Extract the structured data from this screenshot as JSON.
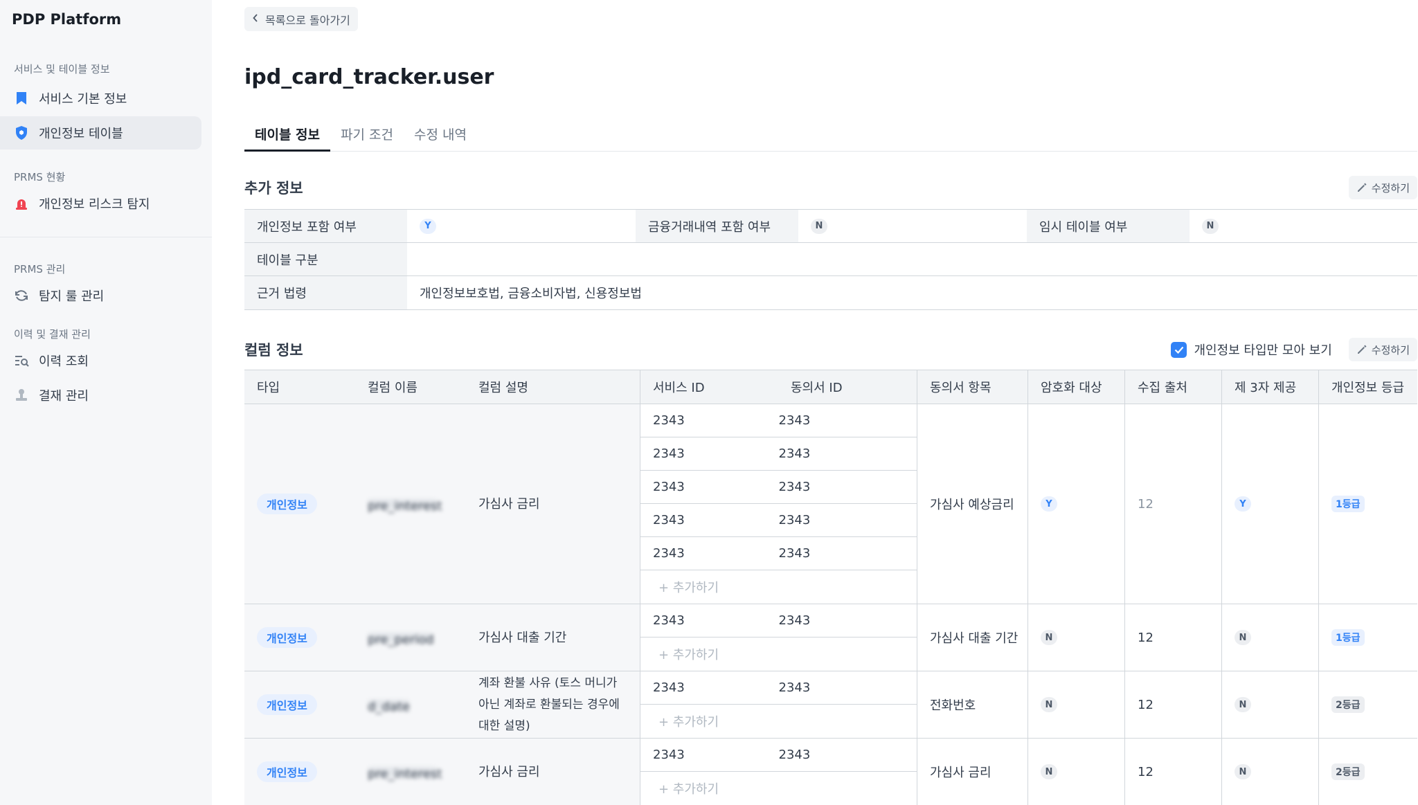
{
  "sidebar": {
    "logo": "PDP Platform",
    "sections": [
      {
        "title": "서비스 및 테이블 정보",
        "items": [
          {
            "label": "서비스 기본 정보",
            "icon": "bookmark-icon"
          },
          {
            "label": "개인정보 테이블",
            "icon": "shield-icon",
            "active": true
          }
        ]
      },
      {
        "title": "PRMS 현황",
        "items": [
          {
            "label": "개인정보 리스크 탐지",
            "icon": "siren-icon"
          }
        ]
      },
      {
        "title": "PRMS 관리",
        "items": [
          {
            "label": "탐지 룰 관리",
            "icon": "refresh-icon"
          }
        ]
      },
      {
        "title": "이력 및 결재 관리",
        "items": [
          {
            "label": "이력 조회",
            "icon": "history-search-icon"
          },
          {
            "label": "결재 관리",
            "icon": "stamp-icon"
          }
        ]
      }
    ]
  },
  "header": {
    "back_label": "목록으로 돌아가기",
    "title": "ipd_card_tracker.user",
    "tabs": [
      "테이블 정보",
      "파기 조건",
      "수정 내역"
    ],
    "active_tab": "테이블 정보"
  },
  "extra_info": {
    "title": "추가 정보",
    "edit_label": "수정하기",
    "row1": [
      {
        "label": "개인정보 포함 여부",
        "value": "Y"
      },
      {
        "label": "금융거래내역 포함 여부",
        "value": "N"
      },
      {
        "label": "임시 테이블 여부",
        "value": "N"
      }
    ],
    "table_type_label": "테이블 구분",
    "table_type_value": "",
    "law_label": "근거 법령",
    "law_value": "개인정보보호법, 금융소비자법, 신용정보법"
  },
  "columns": {
    "title": "컬럼 정보",
    "filter_label": "개인정보 타입만 모아 보기",
    "filter_checked": true,
    "edit_label": "수정하기",
    "add_label": "+ 추가하기",
    "headers": [
      "타입",
      "컬럼 이름",
      "컬럼 설명",
      "서비스 ID",
      "동의서 ID",
      "동의서 항목",
      "암호화 대상",
      "수집 출처",
      "제 3자 제공",
      "개인정보 등급"
    ],
    "rows": [
      {
        "type": "개인정보",
        "name": "pre_interest",
        "desc": "가심사 금리",
        "ids": [
          [
            "2343",
            "2343"
          ],
          [
            "2343",
            "2343"
          ],
          [
            "2343",
            "2343"
          ],
          [
            "2343",
            "2343"
          ],
          [
            "2343",
            "2343"
          ]
        ],
        "item": "가심사 예상금리",
        "enc": "Y",
        "src": "12",
        "third": "Y",
        "grade": "1등급"
      },
      {
        "type": "개인정보",
        "name": "pre_period",
        "desc": "가심사 대출 기간",
        "ids": [
          [
            "2343",
            "2343"
          ]
        ],
        "item": "가심사 대출 기간",
        "enc": "N",
        "src": "12",
        "third": "N",
        "grade": "1등급"
      },
      {
        "type": "개인정보",
        "name": "d_date",
        "desc": "계좌 환불 사유 (토스 머니가 아닌 계좌로 환불되는 경우에 대한 설명)",
        "ids": [
          [
            "2343",
            "2343"
          ]
        ],
        "item": "전화번호",
        "enc": "N",
        "src": "12",
        "third": "N",
        "grade": "2등급"
      },
      {
        "type": "개인정보",
        "name": "pre_interest",
        "desc": "가심사 금리",
        "ids": [
          [
            "2343",
            "2343"
          ]
        ],
        "item": "가심사 금리",
        "enc": "N",
        "src": "12",
        "third": "N",
        "grade": "2등급"
      }
    ]
  }
}
